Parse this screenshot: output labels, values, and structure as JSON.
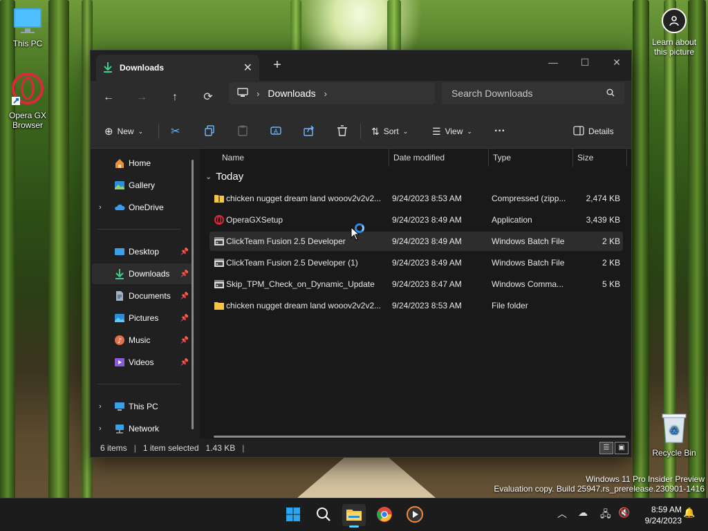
{
  "desktop": {
    "icons": [
      {
        "label": "This PC"
      },
      {
        "label": "Opera GX Browser"
      },
      {
        "label": "Recycle Bin"
      }
    ],
    "learn_about": "Learn about this picture",
    "watermark_line1": "Windows 11 Pro Insider Preview",
    "watermark_line2": "Evaluation copy. Build 25947.rs_prerelease.230901-1416"
  },
  "window": {
    "tab_title": "Downloads",
    "address": {
      "crumb": "Downloads"
    },
    "search_placeholder": "Search Downloads",
    "toolbar": {
      "new_label": "New",
      "sort_label": "Sort",
      "view_label": "View",
      "details_label": "Details"
    },
    "sidebar": {
      "items": [
        {
          "label": "Home"
        },
        {
          "label": "Gallery"
        },
        {
          "label": "OneDrive"
        },
        {
          "label": "Desktop"
        },
        {
          "label": "Downloads"
        },
        {
          "label": "Documents"
        },
        {
          "label": "Pictures"
        },
        {
          "label": "Music"
        },
        {
          "label": "Videos"
        },
        {
          "label": "This PC"
        },
        {
          "label": "Network"
        }
      ]
    },
    "columns": {
      "name": "Name",
      "date": "Date modified",
      "type": "Type",
      "size": "Size"
    },
    "group": "Today",
    "files": [
      {
        "name": "chicken nugget dream land wooov2v2v2...",
        "date": "9/24/2023 8:53 AM",
        "type": "Compressed (zipp...",
        "size": "2,474 KB",
        "icon": "zip-folder-icon"
      },
      {
        "name": "OperaGXSetup",
        "date": "9/24/2023 8:49 AM",
        "type": "Application",
        "size": "3,439 KB",
        "icon": "opera-gx-icon"
      },
      {
        "name": "ClickTeam Fusion 2.5 Developer",
        "date": "9/24/2023 8:49 AM",
        "type": "Windows Batch File",
        "size": "2 KB",
        "icon": "batch-file-icon"
      },
      {
        "name": "ClickTeam Fusion 2.5 Developer (1)",
        "date": "9/24/2023 8:49 AM",
        "type": "Windows Batch File",
        "size": "2 KB",
        "icon": "batch-file-icon"
      },
      {
        "name": "Skip_TPM_Check_on_Dynamic_Update",
        "date": "9/24/2023 8:47 AM",
        "type": "Windows Comma...",
        "size": "5 KB",
        "icon": "command-script-icon"
      },
      {
        "name": "chicken nugget dream land wooov2v2v2...",
        "date": "9/24/2023 8:53 AM",
        "type": "File folder",
        "size": "",
        "icon": "folder-icon"
      }
    ],
    "status": {
      "count": "6 items",
      "selection": "1 item selected",
      "size": "1.43 KB"
    }
  },
  "taskbar": {
    "time": "8:59 AM",
    "date": "9/24/2023"
  },
  "colors": {
    "accent": "#60cdff",
    "folder": "#f5c543",
    "opera": "#e0273a"
  }
}
